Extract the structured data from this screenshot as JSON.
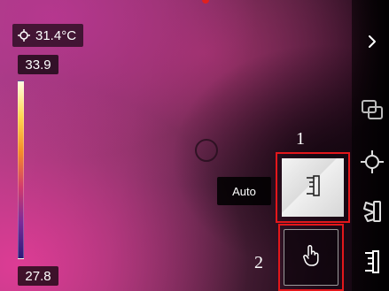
{
  "readout": {
    "temperature": "31.4°C",
    "icon": "crosshair-icon"
  },
  "scale": {
    "max": "33.9",
    "min": "27.8",
    "gradient": [
      "#fffbe0",
      "#ffd750",
      "#f58c28",
      "#d23a6e",
      "#7a2a9a",
      "#2a1a7a"
    ]
  },
  "tooltip": {
    "mode": "Auto"
  },
  "buttons": {
    "auto_icon": "range-auto-icon",
    "manual_icon": "hand-pointer-icon"
  },
  "steps": {
    "one": "1",
    "two": "2"
  },
  "toolbar": {
    "items": [
      {
        "icon": "chevron-right-icon"
      },
      {
        "icon": "image-overlay-icon"
      },
      {
        "icon": "target-icon"
      },
      {
        "icon": "palette-icon"
      },
      {
        "icon": "range-icon"
      }
    ]
  },
  "colors": {
    "highlight": "#e3171b",
    "accent": "#ffffff"
  }
}
